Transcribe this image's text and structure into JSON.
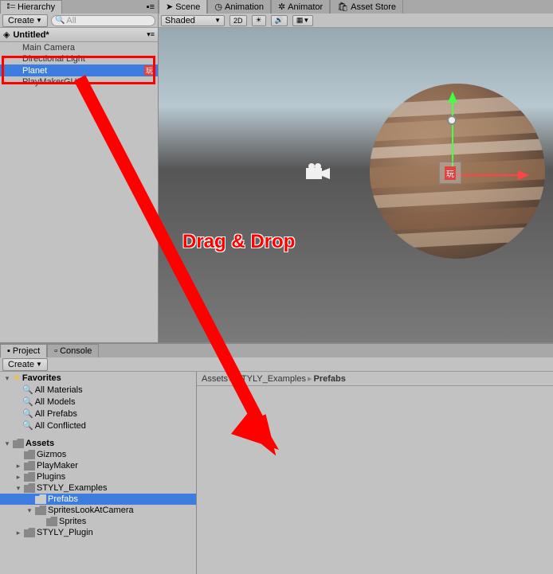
{
  "hierarchy": {
    "tab_label": "Hierarchy",
    "create_label": "Create",
    "search_placeholder": "All",
    "scene_name": "Untitled*",
    "items": [
      "Main Camera",
      "Directional Light",
      "Planet",
      "PlayMakerGUI"
    ],
    "selected_index": 2
  },
  "scene": {
    "tabs": [
      "Scene",
      "Animation",
      "Animator",
      "Asset Store"
    ],
    "shading_mode": "Shaded",
    "mode_2d": "2D",
    "annotation_text": "Drag & Drop"
  },
  "project": {
    "tabs": [
      "Project",
      "Console"
    ],
    "create_label": "Create",
    "favorites_label": "Favorites",
    "favorites": [
      "All Materials",
      "All Models",
      "All Prefabs",
      "All Conflicted"
    ],
    "assets_label": "Assets",
    "assets_tree": [
      {
        "label": "Gizmos",
        "depth": 1,
        "open": false,
        "sel": false
      },
      {
        "label": "PlayMaker",
        "depth": 1,
        "open": false,
        "sel": false,
        "arrow": true
      },
      {
        "label": "Plugins",
        "depth": 1,
        "open": false,
        "sel": false,
        "arrow": true
      },
      {
        "label": "STYLY_Examples",
        "depth": 1,
        "open": true,
        "sel": false,
        "arrow": true
      },
      {
        "label": "Prefabs",
        "depth": 2,
        "open": false,
        "sel": true
      },
      {
        "label": "SpritesLookAtCamera",
        "depth": 2,
        "open": true,
        "sel": false,
        "arrow": true
      },
      {
        "label": "Sprites",
        "depth": 3,
        "open": false,
        "sel": false
      },
      {
        "label": "STYLY_Plugin",
        "depth": 1,
        "open": false,
        "sel": false,
        "arrow": true
      }
    ],
    "breadcrumb": [
      "Assets",
      "STYLY_Examples",
      "Prefabs"
    ]
  }
}
